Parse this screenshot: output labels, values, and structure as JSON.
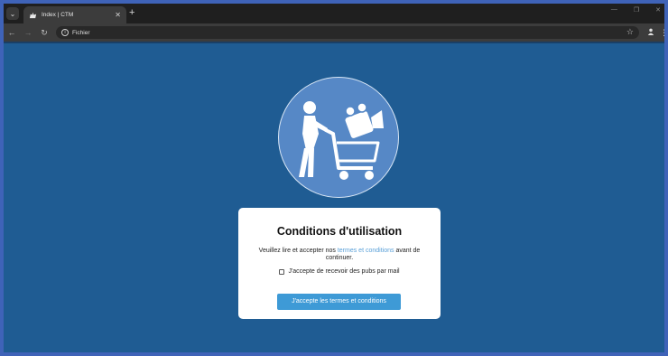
{
  "browser": {
    "tab_title": "Index | CTM",
    "url_label": "Fichier"
  },
  "card": {
    "title": "Conditions d'utilisation",
    "text_before": "Veuillez lire et accepter nos ",
    "link_text": "termes et conditions",
    "text_after": " avant de continuer.",
    "checkbox_label": "J'accepte de recevoir des pubs par mail",
    "checkbox_checked": false,
    "button_label": "J'accepte les termes et conditions"
  },
  "colors": {
    "page_background": "#1f5c93",
    "logo_circle": "#5688c6",
    "button": "#3e9ad6",
    "link": "#5aa0d8"
  },
  "icons": [
    "chevron-down-icon",
    "cat-favicon-icon",
    "close-icon",
    "plus-icon",
    "back-icon",
    "forward-icon",
    "reload-icon",
    "info-icon",
    "star-icon",
    "profile-icon",
    "kebab-menu-icon",
    "shopping-cart-logo-icon"
  ]
}
